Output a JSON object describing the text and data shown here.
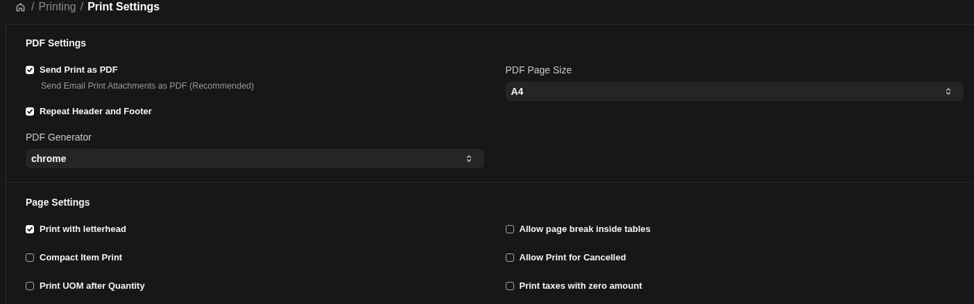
{
  "breadcrumb": [
    {
      "separator": "/",
      "label": "Printing"
    },
    {
      "separator": "/",
      "label": "Print Settings"
    }
  ],
  "sections": [
    {
      "title": "PDF Settings",
      "columns": [
        [
          {
            "kind": "checkbox",
            "label": "Send Print as PDF",
            "checked": true,
            "description": "Send Email Print Attachments as PDF (Recommended)"
          },
          {
            "kind": "checkbox",
            "label": "Repeat Header and Footer",
            "checked": true
          },
          {
            "kind": "select",
            "label": "PDF Generator",
            "value": "chrome"
          }
        ],
        [
          {
            "kind": "select",
            "label": "PDF Page Size",
            "value": "A4"
          }
        ]
      ]
    },
    {
      "title": "Page Settings",
      "columns": [
        [
          {
            "kind": "checkbox",
            "label": "Print with letterhead",
            "checked": true
          },
          {
            "kind": "checkbox",
            "label": "Compact Item Print",
            "checked": false
          },
          {
            "kind": "checkbox",
            "label": "Print UOM after Quantity",
            "checked": false
          }
        ],
        [
          {
            "kind": "checkbox",
            "label": "Allow page break inside tables",
            "checked": false
          },
          {
            "kind": "checkbox",
            "label": "Allow Print for Cancelled",
            "checked": false
          },
          {
            "kind": "checkbox",
            "label": "Print taxes with zero amount",
            "checked": false
          }
        ]
      ]
    }
  ]
}
